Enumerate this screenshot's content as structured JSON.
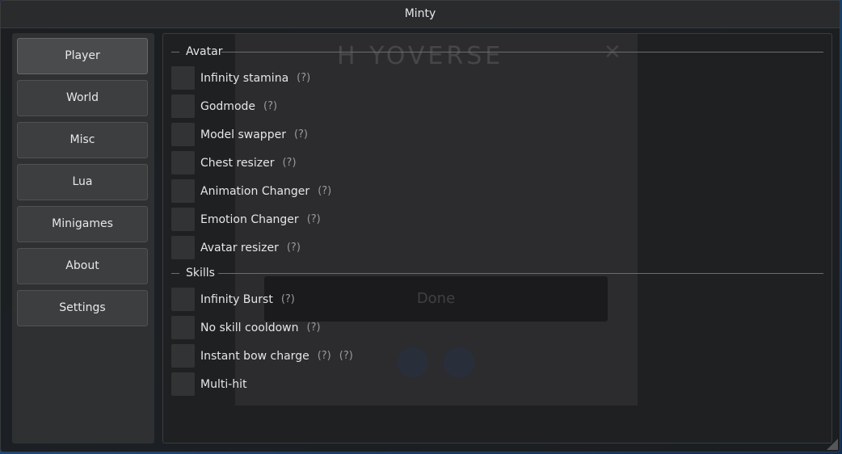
{
  "window": {
    "title": "Minty"
  },
  "sidebar": {
    "items": [
      {
        "label": "Player",
        "active": true
      },
      {
        "label": "World"
      },
      {
        "label": "Misc"
      },
      {
        "label": "Lua"
      },
      {
        "label": "Minigames"
      },
      {
        "label": "About"
      },
      {
        "label": "Settings"
      }
    ]
  },
  "background": {
    "logo_text": "H  YOVERSE",
    "button_text": "Done"
  },
  "sections": {
    "avatar": {
      "title": "Avatar",
      "options": [
        {
          "label": "Infinity stamina",
          "help": "(?)"
        },
        {
          "label": "Godmode",
          "help": "(?)"
        },
        {
          "label": "Model swapper",
          "help": "(?)"
        },
        {
          "label": "Chest resizer",
          "help": "(?)"
        },
        {
          "label": "Animation Changer",
          "help": "(?)"
        },
        {
          "label": "Emotion Changer",
          "help": "(?)"
        },
        {
          "label": "Avatar resizer",
          "help": "(?)"
        }
      ]
    },
    "skills": {
      "title": "Skills",
      "options": [
        {
          "label": "Infinity Burst",
          "help": "(?)"
        },
        {
          "label": "No skill cooldown",
          "help": "(?)"
        },
        {
          "label": "Instant bow charge",
          "help": "(?)",
          "help2": "(?)"
        },
        {
          "label": "Multi-hit"
        }
      ]
    }
  }
}
